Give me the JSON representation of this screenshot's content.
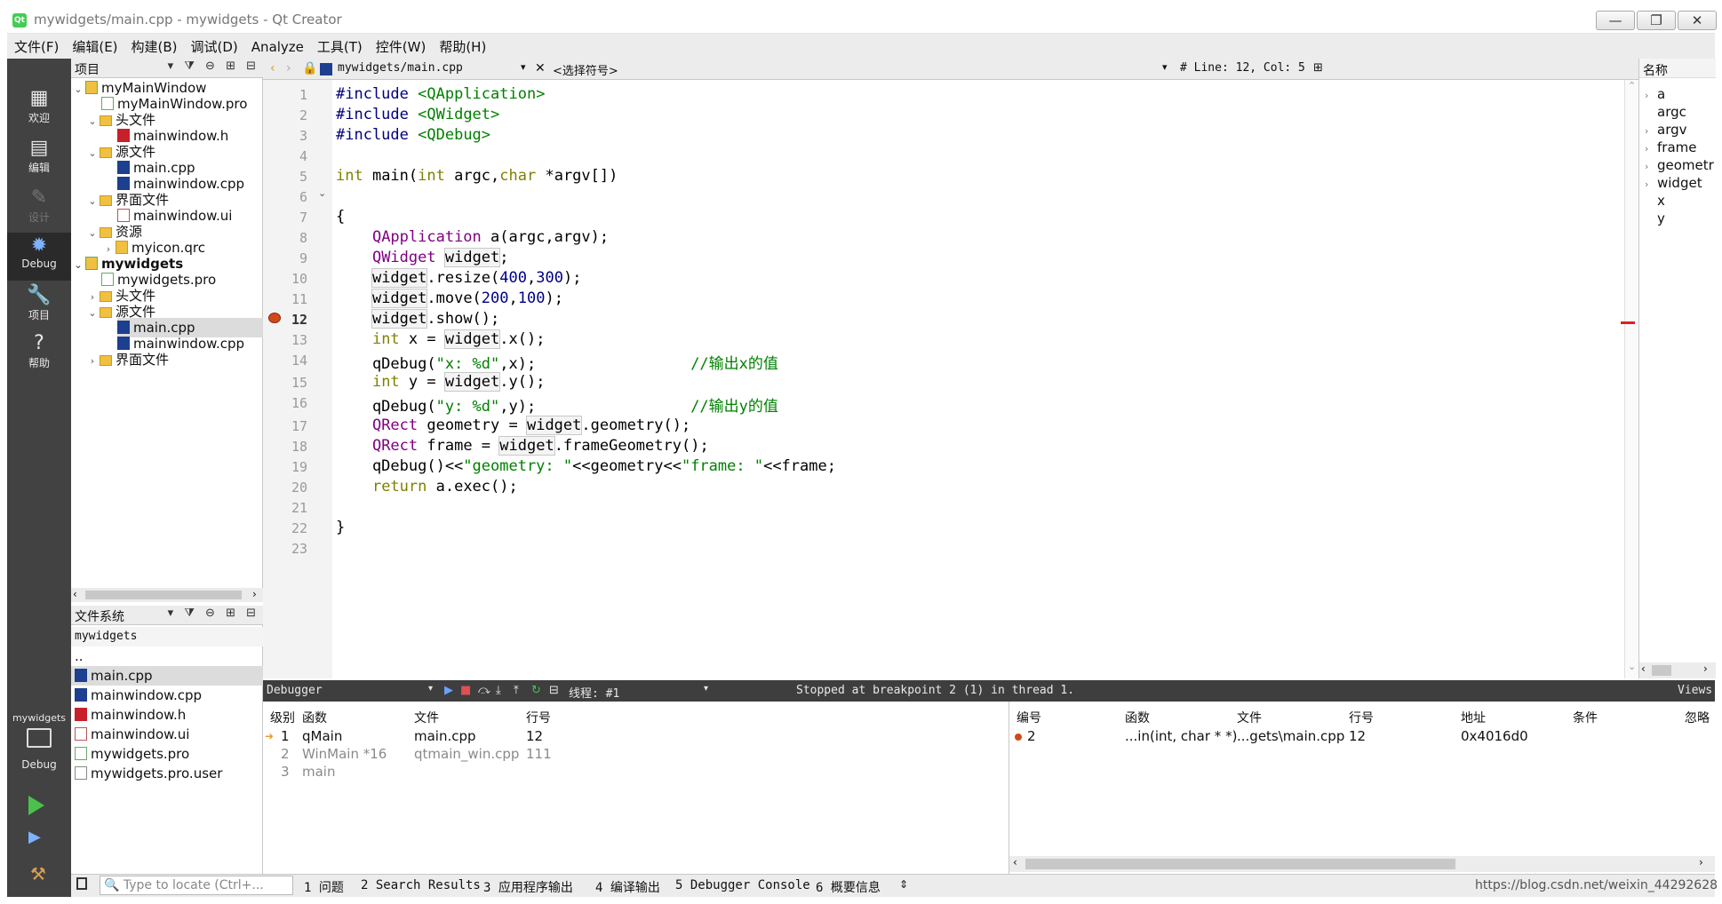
{
  "window": {
    "title": "mywidgets/main.cpp - mywidgets - Qt Creator",
    "app_icon": "Qt",
    "minimize": "—",
    "restore": "❐",
    "close": "✕"
  },
  "menubar": [
    "文件(F)",
    "编辑(E)",
    "构建(B)",
    "调试(D)",
    "Analyze",
    "工具(T)",
    "控件(W)",
    "帮助(H)"
  ],
  "modes": {
    "welcome": "欢迎",
    "edit": "编辑",
    "design": "设计",
    "debug": "Debug",
    "projects": "项目",
    "help": "帮助",
    "kit_project": "mywidgets",
    "kit_mode": "Debug"
  },
  "project_pane": {
    "header": "项目",
    "tools": "▾ ⧩ ⊖ ⊞ ⊟",
    "tree": [
      {
        "label": "myMainWindow",
        "arrow": "⌄"
      },
      {
        "label": "myMainWindow.pro"
      },
      {
        "label": "头文件",
        "arrow": "⌄"
      },
      {
        "label": "mainwindow.h"
      },
      {
        "label": "源文件",
        "arrow": "⌄"
      },
      {
        "label": "main.cpp"
      },
      {
        "label": "mainwindow.cpp"
      },
      {
        "label": "界面文件",
        "arrow": "⌄"
      },
      {
        "label": "mainwindow.ui"
      },
      {
        "label": "资源",
        "arrow": "⌄"
      },
      {
        "label": "myicon.qrc",
        "arrow": "›"
      },
      {
        "label": "mywidgets",
        "arrow": "⌄"
      },
      {
        "label": "mywidgets.pro"
      },
      {
        "label": "头文件",
        "arrow": "›"
      },
      {
        "label": "源文件",
        "arrow": "⌄"
      },
      {
        "label": "main.cpp"
      },
      {
        "label": "mainwindow.cpp"
      },
      {
        "label": "界面文件",
        "arrow": "›"
      }
    ]
  },
  "fs_pane": {
    "header": "文件系统",
    "tools": "▾ ⧩ ⊖ ⊞ ⊟",
    "path": "mywidgets",
    "files": [
      "..",
      "main.cpp",
      "mainwindow.cpp",
      "mainwindow.h",
      "mainwindow.ui",
      "mywidgets.pro",
      "mywidgets.pro.user"
    ]
  },
  "editor": {
    "tab": "mywidgets/main.cpp",
    "symbol": "<选择符号>",
    "position": "#  Line: 12, Col: 5",
    "current_line": 12,
    "breakpoint_line": 12,
    "line_numbers": [
      "1",
      "2",
      "3",
      "4",
      "5",
      "6",
      "7",
      "8",
      "9",
      "10",
      "11",
      "12",
      "13",
      "14",
      "15",
      "16",
      "17",
      "18",
      "19",
      "20",
      "21",
      "22",
      "23"
    ]
  },
  "outline": {
    "header": "名称",
    "items": [
      "a",
      "argc",
      "argv",
      "frame",
      "geometr",
      "widget",
      "x",
      "y"
    ]
  },
  "debugger": {
    "label": "Debugger",
    "thread": "线程: #1",
    "status": "Stopped at breakpoint 2 (1) in thread 1.",
    "views": "Views",
    "stack_headers": [
      "级别",
      "函数",
      "文件",
      "行号"
    ],
    "stack": [
      {
        "level": "1",
        "func": "qMain",
        "file": "main.cpp",
        "line": "12"
      },
      {
        "level": "2",
        "func": "WinMain *16",
        "file": "qtmain_win.cpp",
        "line": "111"
      },
      {
        "level": "3",
        "func": "main",
        "file": "",
        "line": ""
      }
    ],
    "bp_headers": [
      "编号",
      "函数",
      "文件",
      "行号",
      "地址",
      "条件",
      "忽略"
    ],
    "breakpoints": [
      {
        "id": "2",
        "func": "...in(int, char * *)",
        "file": "...gets\\main.cpp",
        "line": "12",
        "addr": "0x4016d0"
      }
    ]
  },
  "statusbar": {
    "locate_placeholder": "Type to locate (Ctrl+...",
    "tabs": [
      "1 问题",
      "2 Search Results",
      "3 应用程序输出",
      "4 编译输出",
      "5 Debugger Console",
      "6 概要信息"
    ],
    "watermark": "https://blog.csdn.net/weixin_44292628"
  },
  "colors": {
    "keyword": "#808000",
    "string": "#008000",
    "type": "#800080",
    "number": "#000080",
    "breakpoint": "#d24a1a",
    "modebar": "#424242"
  }
}
